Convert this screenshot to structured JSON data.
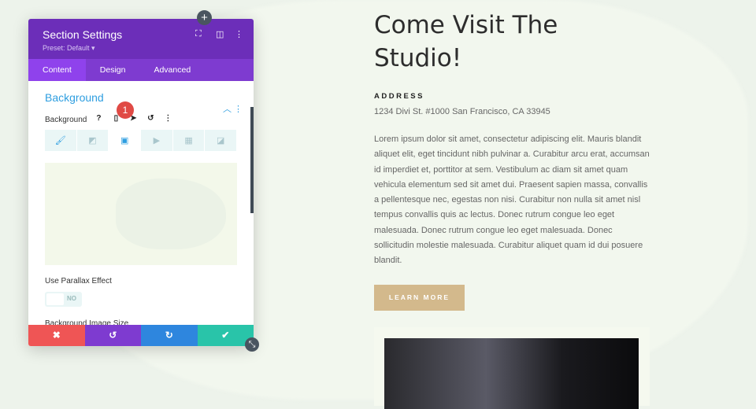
{
  "panel": {
    "title": "Section Settings",
    "preset": "Preset: Default ▾",
    "tabs": [
      {
        "label": "Content",
        "active": true
      },
      {
        "label": "Design"
      },
      {
        "label": "Advanced"
      }
    ],
    "section_title": "Background",
    "bg_label": "Background",
    "badge": "1",
    "parallax_label": "Use Parallax Effect",
    "parallax_value": "NO",
    "image_size_label": "Background Image Size",
    "colors": {
      "header": "#6c2eb9",
      "cancel": "#ef5555",
      "undo": "#7e3bd0",
      "redo": "#2e86de",
      "save": "#29c4a9"
    }
  },
  "page": {
    "heading": "Come Visit The Studio!",
    "address_heading": "ADDRESS",
    "address": "1234 Divi St. #1000 San Francisco, CA 33945",
    "body": "Lorem ipsum dolor sit amet, consectetur adipiscing elit. Mauris blandit aliquet elit, eget tincidunt nibh pulvinar a. Curabitur arcu erat, accumsan id imperdiet et, porttitor at sem. Vestibulum ac diam sit amet quam vehicula elementum sed sit amet dui. Praesent sapien massa, convallis a pellentesque nec, egestas non nisi. Curabitur non nulla sit amet nisl tempus convallis quis ac lectus. Donec rutrum congue leo eget malesuada. Donec rutrum congue leo eget malesuada. Donec sollicitudin molestie malesuada. Curabitur aliquet quam id dui posuere blandit.",
    "button": "LEARN MORE",
    "button_color": "#d3b98c"
  }
}
